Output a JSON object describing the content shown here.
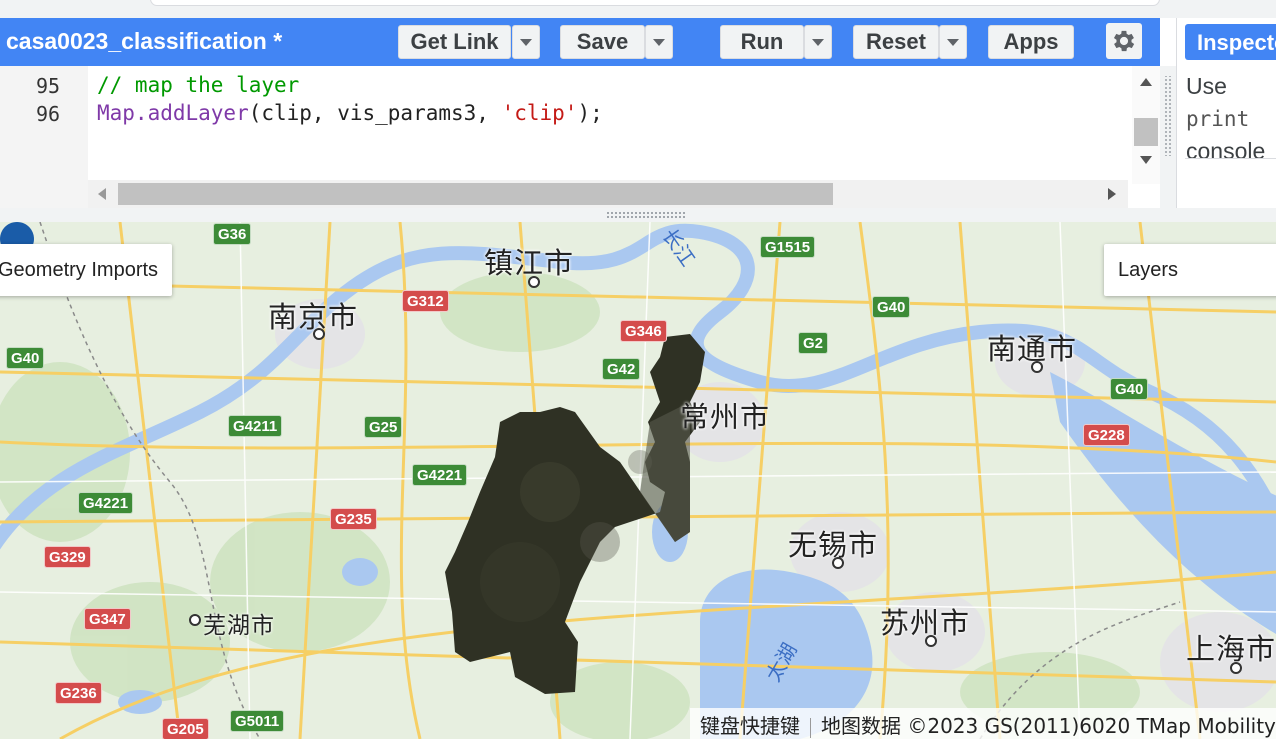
{
  "editor_header": {
    "script_title": "casa0023_classification *",
    "buttons": {
      "get_link": "Get Link",
      "save": "Save",
      "run": "Run",
      "reset": "Reset",
      "apps": "Apps"
    },
    "icons": {
      "settings": "gear-icon",
      "dropdown": "chevron-down-icon"
    }
  },
  "code_editor": {
    "lines": [
      {
        "number": "95",
        "comment": "// map the layer"
      },
      {
        "number": "96",
        "call": "Map.addLayer",
        "open": "(clip, vis_params3, ",
        "string": "'clip'",
        "close": ");"
      }
    ]
  },
  "right_panel": {
    "tab_label": "Inspector",
    "hint_prefix": "Use",
    "hint_code": "print",
    "hint_suffix": "console"
  },
  "map": {
    "buttons": {
      "geometry_imports": "Geometry Imports",
      "layers": "Layers"
    },
    "cities": [
      {
        "name": "镇江市"
      },
      {
        "name": "南京市"
      },
      {
        "name": "南通市"
      },
      {
        "name": "常州市"
      },
      {
        "name": "无锡市"
      },
      {
        "name": "苏州市"
      },
      {
        "name": "芜湖市"
      },
      {
        "name": "上海市"
      }
    ],
    "water_labels": {
      "river": "长江",
      "lake": "太湖"
    },
    "road_shields": [
      {
        "label": "G36",
        "color": "green"
      },
      {
        "label": "G1515",
        "color": "green"
      },
      {
        "label": "G312",
        "color": "red"
      },
      {
        "label": "G40",
        "color": "green"
      },
      {
        "label": "G346",
        "color": "red"
      },
      {
        "label": "G2",
        "color": "green"
      },
      {
        "label": "G40",
        "color": "green"
      },
      {
        "label": "G42",
        "color": "green"
      },
      {
        "label": "G4211",
        "color": "green"
      },
      {
        "label": "G25",
        "color": "green"
      },
      {
        "label": "G40",
        "color": "green"
      },
      {
        "label": "G228",
        "color": "red"
      },
      {
        "label": "G4221",
        "color": "green"
      },
      {
        "label": "G4221",
        "color": "green"
      },
      {
        "label": "G235",
        "color": "red"
      },
      {
        "label": "G329",
        "color": "red"
      },
      {
        "label": "G347",
        "color": "red"
      },
      {
        "label": "G236",
        "color": "red"
      },
      {
        "label": "G205",
        "color": "red"
      },
      {
        "label": "G5011",
        "color": "green"
      }
    ],
    "marker": "map-pin-icon",
    "attribution": {
      "shortcuts": "键盘快捷键",
      "data": "地图数据 ©2023 GS(2011)6020 TMap Mobility"
    }
  },
  "colors": {
    "header_blue": "#4285f4",
    "green_shield": "#3d8b37",
    "red_shield": "#d44c4c",
    "water": "#aac8f0",
    "pin": "#1a5ca8"
  }
}
